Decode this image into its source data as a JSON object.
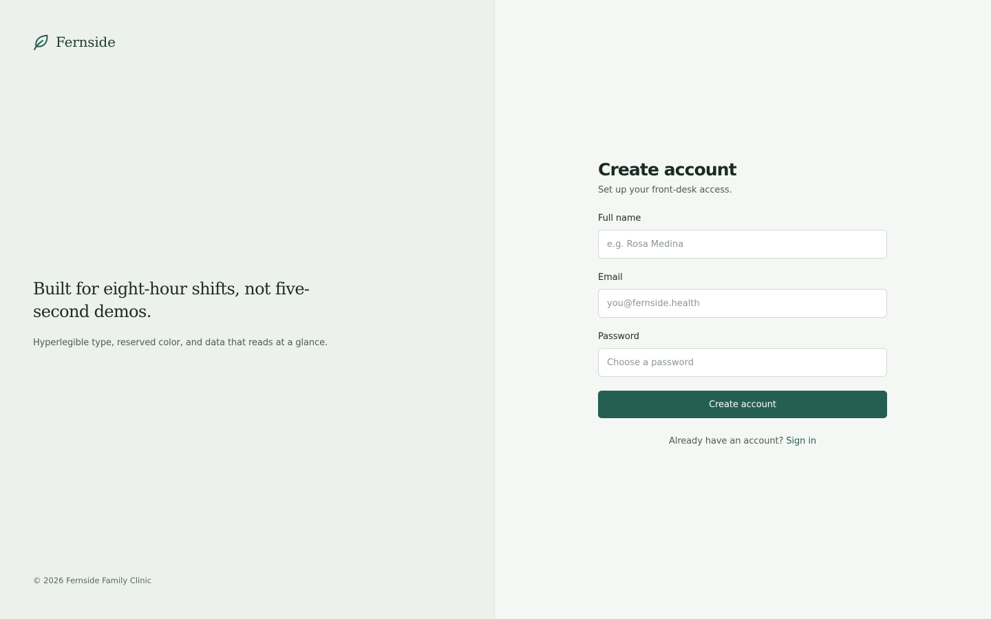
{
  "brand": {
    "name": "Fernside",
    "icon": "leaf-icon",
    "accent_color": "#255f53"
  },
  "hero": {
    "headline": "Built for eight-hour shifts, not five-second demos.",
    "subtext": "Hyperlegible type, reserved color, and data that reads at a glance."
  },
  "footer": {
    "copyright": "© 2026 Fernside Family Clinic"
  },
  "form": {
    "title": "Create account",
    "subtitle": "Set up your front-desk access.",
    "fields": [
      {
        "label": "Full name",
        "placeholder": "e.g. Rosa Medina",
        "value": ""
      },
      {
        "label": "Email",
        "placeholder": "you@fernside.health",
        "value": ""
      },
      {
        "label": "Password",
        "placeholder": "Choose a password",
        "value": ""
      }
    ],
    "submit_label": "Create account",
    "signin_prompt": "Already have an account?",
    "signin_link": "Sign in"
  }
}
